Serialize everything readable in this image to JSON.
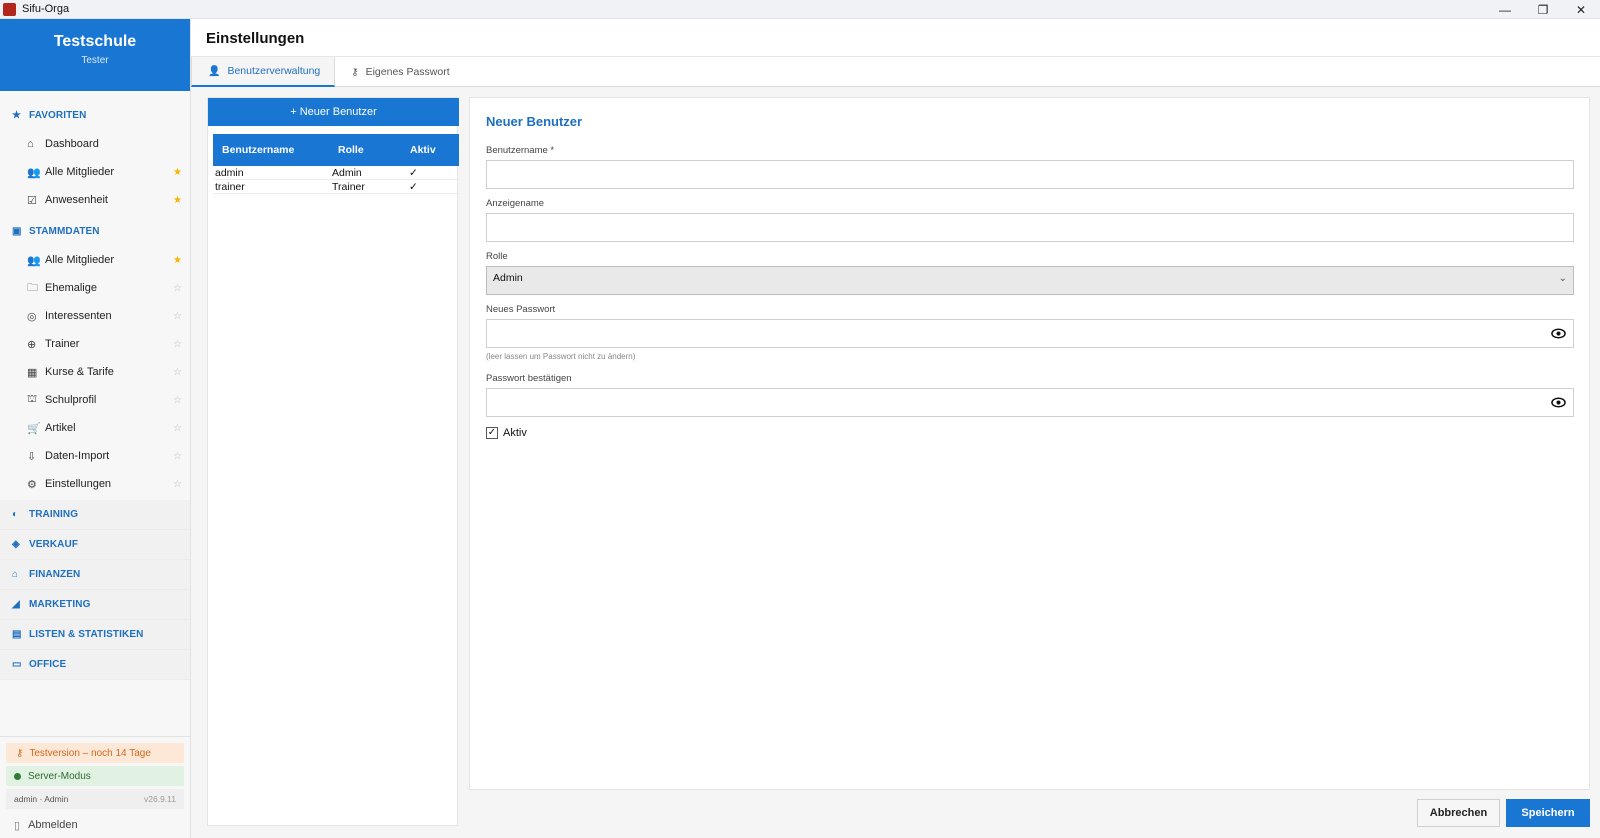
{
  "window": {
    "title": "Sifu-Orga",
    "minimize": "—",
    "maximize": "❐",
    "close": "✕"
  },
  "sidebar": {
    "school_name": "Testschule",
    "user_name": "Tester",
    "favorites": {
      "label": "FAVORITEN",
      "icon": "star-icon",
      "items": [
        {
          "label": "Dashboard",
          "icon": "home-icon",
          "glyph": "⌂",
          "star": ""
        },
        {
          "label": "Alle Mitglieder",
          "icon": "users-icon",
          "glyph": "👥",
          "star": "★"
        },
        {
          "label": "Anwesenheit",
          "icon": "checkbox-icon",
          "glyph": "☑",
          "star": "★"
        }
      ]
    },
    "stammdaten": {
      "label": "STAMMDATEN",
      "items": [
        {
          "label": "Alle Mitglieder",
          "icon": "users-icon",
          "glyph": "👥",
          "star": "★"
        },
        {
          "label": "Ehemalige",
          "icon": "folder-icon",
          "glyph": "🗀",
          "star": "☆"
        },
        {
          "label": "Interessenten",
          "icon": "target-icon",
          "glyph": "◎",
          "star": "☆"
        },
        {
          "label": "Trainer",
          "icon": "whistle-icon",
          "glyph": "⊕",
          "star": "☆"
        },
        {
          "label": "Kurse & Tarife",
          "icon": "calendar-icon",
          "glyph": "▦",
          "star": "☆"
        },
        {
          "label": "Schulprofil",
          "icon": "school-icon",
          "glyph": "⛫",
          "star": "☆"
        },
        {
          "label": "Artikel",
          "icon": "cart-icon",
          "glyph": "🛒",
          "star": "☆"
        },
        {
          "label": "Daten-Import",
          "icon": "import-icon",
          "glyph": "⇩",
          "star": "☆"
        },
        {
          "label": "Einstellungen",
          "icon": "gear-icon",
          "glyph": "⚙",
          "star": "☆"
        }
      ]
    },
    "sections": [
      {
        "label": "TRAINING",
        "icon": "training-icon",
        "glyph": "◐"
      },
      {
        "label": "VERKAUF",
        "icon": "sale-icon",
        "glyph": "◈"
      },
      {
        "label": "FINANZEN",
        "icon": "bank-icon",
        "glyph": "⌂"
      },
      {
        "label": "MARKETING",
        "icon": "megaphone-icon",
        "glyph": "◢"
      },
      {
        "label": "LISTEN & STATISTIKEN",
        "icon": "stats-icon",
        "glyph": "▤"
      },
      {
        "label": "OFFICE",
        "icon": "office-icon",
        "glyph": "▭"
      }
    ],
    "trial": "Testversion – noch 14 Tage",
    "server": "Server-Modus",
    "who": "admin · Admin",
    "version": "v26.9.11",
    "logout": "Abmelden"
  },
  "main": {
    "title": "Einstellungen",
    "tabs": [
      {
        "label": "Benutzerverwaltung",
        "icon": "user-icon",
        "glyph": "👤"
      },
      {
        "label": "Eigenes Passwort",
        "icon": "key-icon",
        "glyph": "⚷"
      }
    ],
    "new_user_button": "+ Neuer Benutzer",
    "table": {
      "headers": [
        "Benutzername",
        "Rolle",
        "Aktiv"
      ],
      "rows": [
        {
          "username": "admin",
          "role": "Admin",
          "active": "✓"
        },
        {
          "username": "trainer",
          "role": "Trainer",
          "active": "✓"
        }
      ]
    },
    "form": {
      "title": "Neuer Benutzer",
      "username_label": "Benutzername *",
      "username_value": "",
      "display_label": "Anzeigename",
      "display_value": "",
      "role_label": "Rolle",
      "role_value": "Admin",
      "password_label": "Neues Passwort",
      "password_hint": "(leer lassen um Passwort nicht zu ändern)",
      "confirm_label": "Passwort bestätigen",
      "active_label": "Aktiv",
      "active_checked": true
    },
    "cancel_button": "Abbrechen",
    "save_button": "Speichern"
  },
  "colors": {
    "accent": "#1976d2",
    "star_on": "#f4b400",
    "trial_bg": "#fde8d8",
    "server_bg": "#e1f1e2"
  }
}
